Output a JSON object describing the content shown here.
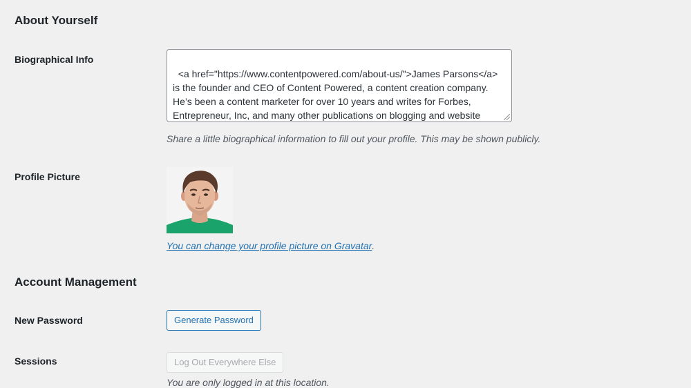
{
  "about": {
    "title": "About Yourself",
    "bio_label": "Biographical Info",
    "bio_value": "<a href=\"https://www.contentpowered.com/about-us/\">James Parsons</a> is the founder and CEO of Content Powered, a content creation company. He’s been a content marketer for over 10 years and writes for Forbes, Entrepreneur, Inc, and many other publications on blogging and website strategy.",
    "bio_description": "Share a little biographical information to fill out your profile. This may be shown publicly.",
    "picture_label": "Profile Picture",
    "gravatar_link": "You can change your profile picture on Gravatar",
    "gravatar_suffix": "."
  },
  "account": {
    "title": "Account Management",
    "password_label": "New Password",
    "generate_password_button": "Generate Password",
    "sessions_label": "Sessions",
    "logout_button": "Log Out Everywhere Else",
    "sessions_description_partial": "You are only logged in at this location."
  },
  "colors": {
    "background": "#f0f0f1",
    "link": "#2271b1",
    "text": "#1d2327",
    "muted": "#50575e",
    "disabled": "#a7aaad",
    "avatar_shirt": "#1aa36b"
  }
}
